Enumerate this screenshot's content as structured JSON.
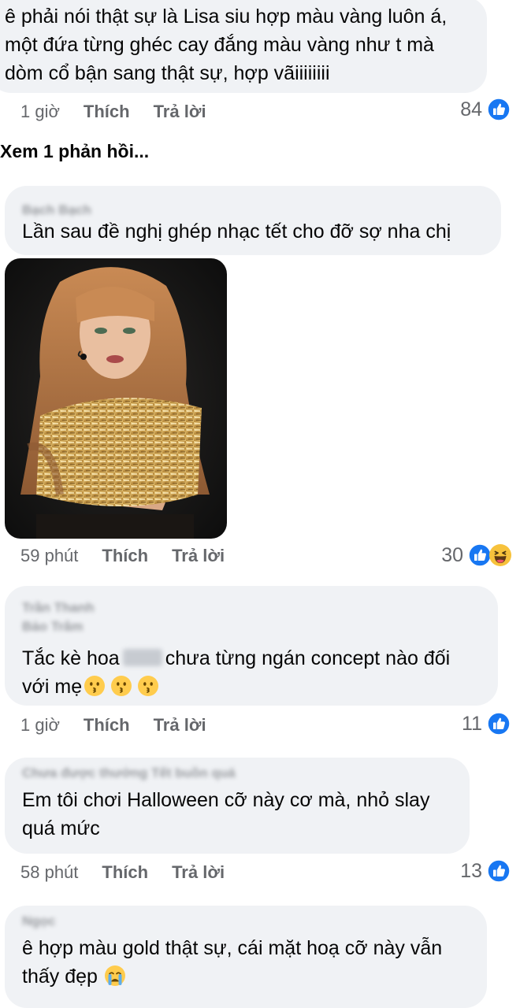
{
  "comments": [
    {
      "author": "",
      "text": "ê phải nói thật sự là Lisa siu hợp màu vàng luôn á, một đứa từng ghéc cay đắng màu vàng như t mà dòm cổ bận sang thật sự, hợp vãiiiiiiii",
      "time": "1 giờ",
      "like_label": "Thích",
      "reply_label": "Trả lời",
      "reaction_count": "84",
      "reactions": [
        "like-icon"
      ]
    },
    {
      "author": "Bạch Bạch",
      "text": "Lần sau đề nghị ghép nhạc tết cho đỡ sợ nha chị",
      "time": "59 phút",
      "like_label": "Thích",
      "reply_label": "Trả lời",
      "reaction_count": "30",
      "reactions": [
        "like-icon",
        "haha-icon"
      ]
    },
    {
      "author_line_1": "Trần Thanh",
      "author": "Bảo Trâm",
      "text_before": "Tắc kè hoa",
      "text_after": "chưa từng ngán concept nào đối với mẹ",
      "emojis": [
        "kissing-face-icon",
        "kissing-face-icon",
        "kissing-face-icon"
      ],
      "time": "1 giờ",
      "like_label": "Thích",
      "reply_label": "Trả lời",
      "reaction_count": "11",
      "reactions": [
        "like-icon"
      ]
    },
    {
      "author": "Chưa được thưởng Tết buồn quá",
      "text": "Em tôi chơi Halloween cỡ này cơ mà, nhỏ slay quá mức",
      "time": "58 phút",
      "like_label": "Thích",
      "reply_label": "Trả lời",
      "reaction_count": "13",
      "reactions": [
        "like-icon"
      ]
    },
    {
      "author": "Ngọc",
      "text": "ê hợp màu gold thật sự, cái mặt hoạ cỡ này vẫn thấy đẹp",
      "emojis": [
        "crying-face-icon"
      ]
    }
  ],
  "view_replies": "Xem 1 phản hồi...",
  "colors": {
    "bubble": "#f0f2f5",
    "meta_text": "#65676b",
    "like_blue": "#1877f2",
    "haha_yellow": "#f7c23c"
  }
}
